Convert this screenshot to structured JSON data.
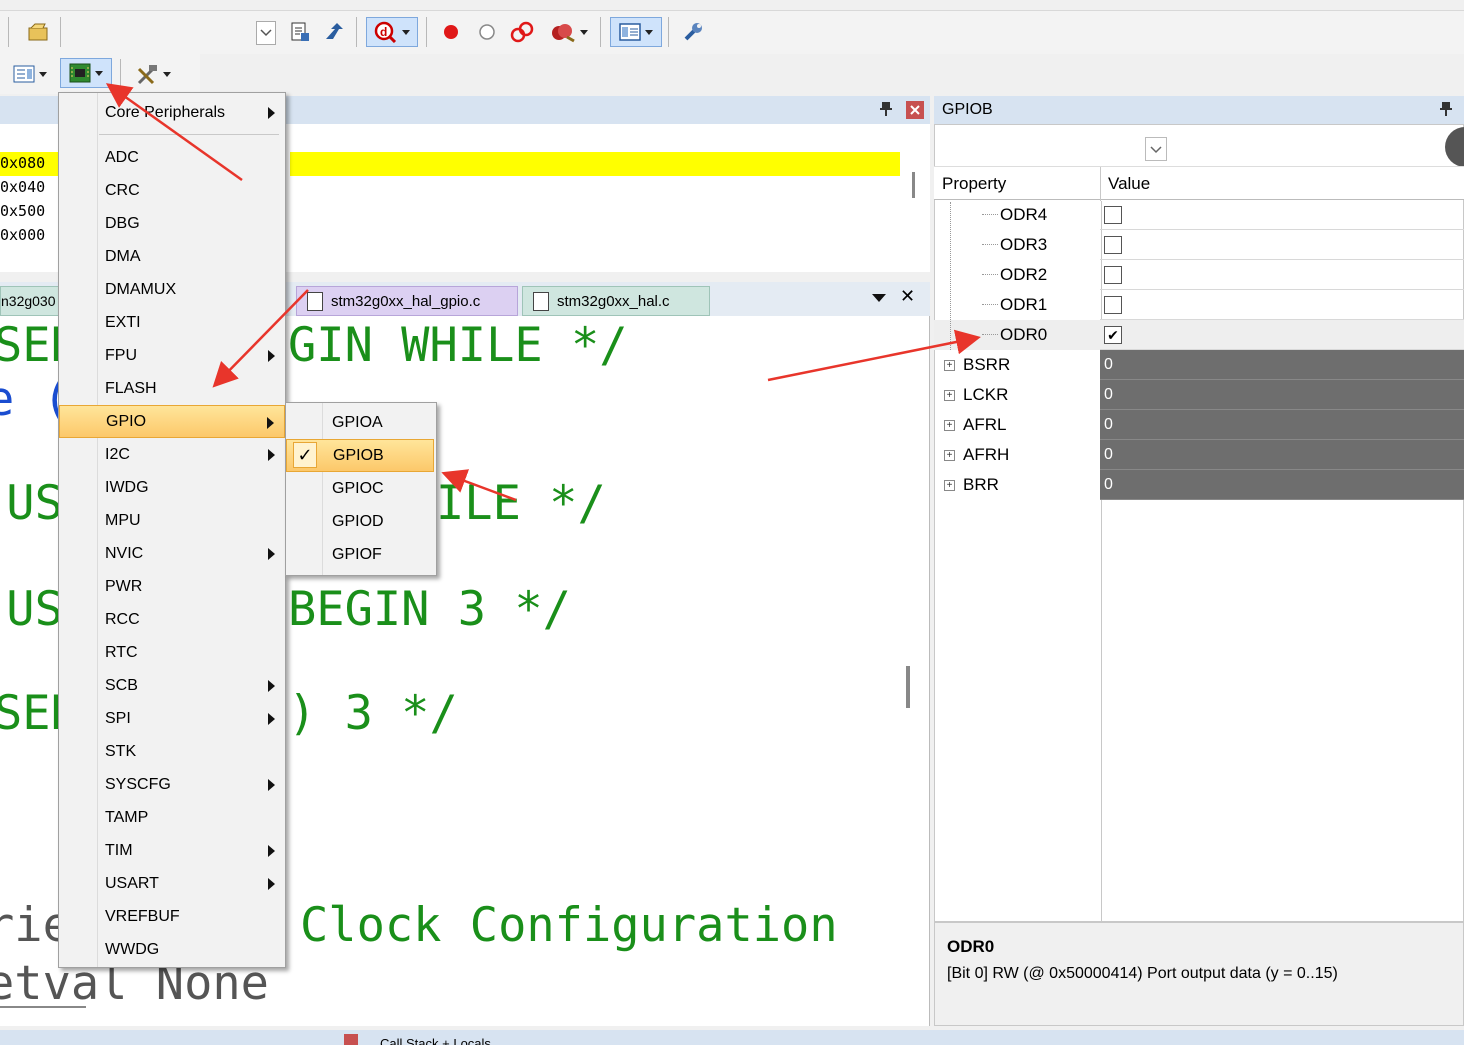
{
  "toolbar": {
    "icons": [
      "open-icon",
      "dropdown-arrow-icon",
      "build-icon",
      "download-icon",
      "debug-icon",
      "breakpoint-icon",
      "clear-breakpoint-icon",
      "breakpoints-icon",
      "kill-breakpoints-icon",
      "window-layout-icon",
      "wrench-icon",
      "registers-icon",
      "system-viewer-icon",
      "tools-icon"
    ]
  },
  "memory": {
    "lines": [
      "0x080",
      "0x040",
      "0x500",
      "0x000"
    ]
  },
  "editor": {
    "tabs": [
      {
        "label": "stm32g0xx_hal_gpio.c"
      },
      {
        "label": "stm32g0xx_hal.c"
      }
    ],
    "left_tab_fragment": "n32g030",
    "code_fragments": {
      "f1": "SER",
      "f2": "GIN WHILE */",
      "f3": "e (",
      "f4": " US",
      "f5": "ILE */",
      "f6": " US",
      "f7": "BEGIN 3 */",
      "f8": "SER",
      "f9": ") 3 */",
      "f10": "rie",
      "f11": "Clock Configuration",
      "f12": "etval None"
    }
  },
  "peripherals_menu": {
    "items": [
      {
        "label": "Core Peripherals",
        "submenu": true
      },
      {
        "label": "ADC",
        "submenu": false
      },
      {
        "label": "CRC",
        "submenu": false
      },
      {
        "label": "DBG",
        "submenu": false
      },
      {
        "label": "DMA",
        "submenu": false
      },
      {
        "label": "DMAMUX",
        "submenu": false
      },
      {
        "label": "EXTI",
        "submenu": false
      },
      {
        "label": "FPU",
        "submenu": true
      },
      {
        "label": "FLASH",
        "submenu": false
      },
      {
        "label": "GPIO",
        "submenu": true,
        "highlighted": true
      },
      {
        "label": "I2C",
        "submenu": true
      },
      {
        "label": "IWDG",
        "submenu": false
      },
      {
        "label": "MPU",
        "submenu": false
      },
      {
        "label": "NVIC",
        "submenu": true
      },
      {
        "label": "PWR",
        "submenu": false
      },
      {
        "label": "RCC",
        "submenu": false
      },
      {
        "label": "RTC",
        "submenu": false
      },
      {
        "label": "SCB",
        "submenu": true
      },
      {
        "label": "SPI",
        "submenu": true
      },
      {
        "label": "STK",
        "submenu": false
      },
      {
        "label": "SYSCFG",
        "submenu": true
      },
      {
        "label": "TAMP",
        "submenu": false
      },
      {
        "label": "TIM",
        "submenu": true
      },
      {
        "label": "USART",
        "submenu": true
      },
      {
        "label": "VREFBUF",
        "submenu": false
      },
      {
        "label": "WWDG",
        "submenu": false
      }
    ]
  },
  "gpio_submenu": {
    "items": [
      {
        "label": "GPIOA",
        "checked": false
      },
      {
        "label": "GPIOB",
        "checked": true
      },
      {
        "label": "GPIOC",
        "checked": false
      },
      {
        "label": "GPIOD",
        "checked": false
      },
      {
        "label": "GPIOF",
        "checked": false
      }
    ],
    "check_mark": "✓"
  },
  "property_panel": {
    "title": "GPIOB",
    "pin_icon": "pin-icon",
    "columns": {
      "property": "Property",
      "value": "Value"
    },
    "rows": [
      {
        "name": "ODR4",
        "kind": "check",
        "checked": false
      },
      {
        "name": "ODR3",
        "kind": "check",
        "checked": false
      },
      {
        "name": "ODR2",
        "kind": "check",
        "checked": false
      },
      {
        "name": "ODR1",
        "kind": "check",
        "checked": false
      },
      {
        "name": "ODR0",
        "kind": "check",
        "checked": true
      },
      {
        "name": "BSRR",
        "kind": "reg",
        "value": "0"
      },
      {
        "name": "LCKR",
        "kind": "reg",
        "value": "0"
      },
      {
        "name": "AFRL",
        "kind": "reg",
        "value": "0"
      },
      {
        "name": "AFRH",
        "kind": "reg",
        "value": "0"
      },
      {
        "name": "BRR",
        "kind": "reg",
        "value": "0"
      }
    ],
    "check_glyph": "✔",
    "expand_glyph": "+",
    "description": {
      "title": "ODR0",
      "text": "[Bit 0] RW (@ 0x50000414) Port output data (y = 0..15)"
    }
  },
  "bottom_panel": {
    "label": "Call Stack + Locals"
  },
  "colors": {
    "annotation_arrow": "#e8352b",
    "highlight_line": "#ffff00",
    "code_green": "#1a8f1a",
    "menu_hot": "#fcc86a",
    "reg_value_bg": "#6e6e6e"
  }
}
